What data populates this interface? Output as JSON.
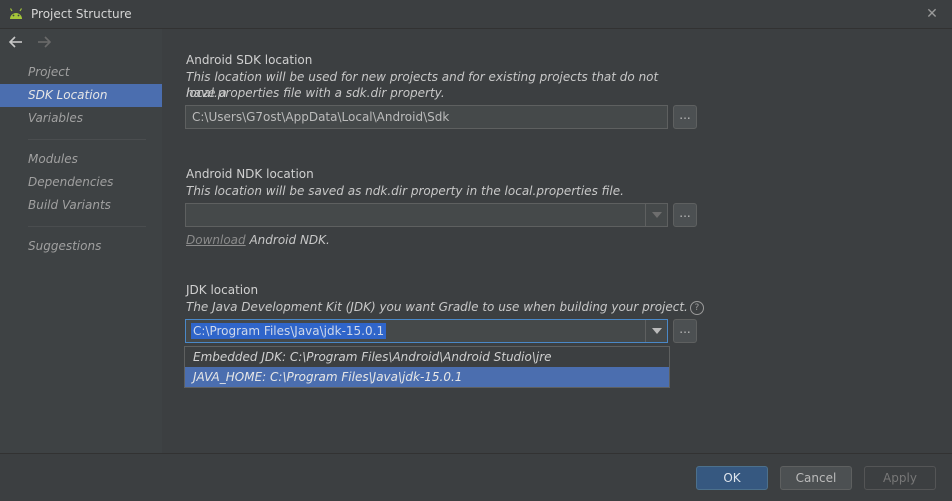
{
  "window": {
    "title": "Project Structure",
    "close_symbol": "✕"
  },
  "sidebar": {
    "items": [
      {
        "label": "Project"
      },
      {
        "label": "SDK Location"
      },
      {
        "label": "Variables"
      },
      {
        "label": "Modules"
      },
      {
        "label": "Dependencies"
      },
      {
        "label": "Build Variants"
      },
      {
        "label": "Suggestions"
      }
    ],
    "selected": "SDK Location"
  },
  "sdk": {
    "title": "Android SDK location",
    "desc_line1": "This location will be used for new projects and for existing projects that do not have a",
    "desc_line2": "local.properties file with a sdk.dir property.",
    "path": "C:\\Users\\G7ost\\AppData\\Local\\Android\\Sdk",
    "browse_label": "..."
  },
  "ndk": {
    "title": "Android NDK location",
    "desc": "This location will be saved as ndk.dir property in the local.properties file.",
    "path": "",
    "browse_label": "...",
    "download_link": "Download",
    "download_suffix": " Android NDK."
  },
  "jdk": {
    "title": "JDK location",
    "desc": "The Java Development Kit (JDK) you want Gradle to use when building your project.",
    "help_symbol": "?",
    "selected_path": "C:\\Program Files\\Java\\jdk-15.0.1",
    "browse_label": "...",
    "options": [
      {
        "label": "Embedded JDK: C:\\Program Files\\Android\\Android Studio\\jre"
      },
      {
        "label": "JAVA_HOME: C:\\Program Files\\Java\\jdk-15.0.1"
      }
    ]
  },
  "footer": {
    "ok_label": "OK",
    "cancel_label": "Cancel",
    "apply_label": "Apply"
  },
  "colors": {
    "accent": "#4b6eaf",
    "background": "#3c3f41",
    "android_green": "#a4c639"
  }
}
